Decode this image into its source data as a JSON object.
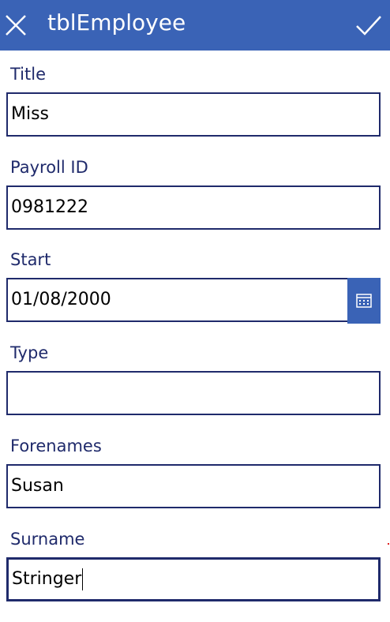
{
  "header": {
    "title": "tblEmployee",
    "close_icon": "close-icon",
    "submit_icon": "checkmark-icon",
    "background": "#3a63b6"
  },
  "form": {
    "fields": [
      {
        "label": "Title",
        "value": "Miss"
      },
      {
        "label": "Payroll ID",
        "value": "0981222"
      },
      {
        "label": "Start",
        "value": "01/08/2000",
        "icon": "calendar-icon"
      },
      {
        "label": "Type",
        "value": ""
      },
      {
        "label": "Forenames",
        "value": "Susan"
      },
      {
        "label": "Surname",
        "value": "Stringer"
      }
    ]
  },
  "colors": {
    "label": "#1f2a6b",
    "border": "#1f2a6b",
    "accent": "#3a63b6"
  }
}
